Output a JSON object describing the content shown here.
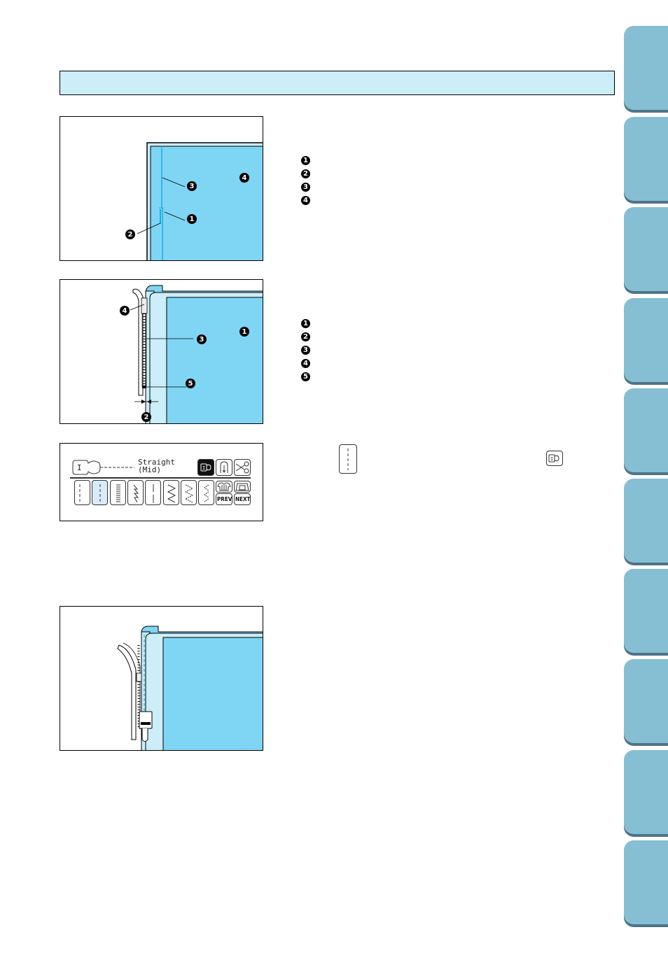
{
  "header": {
    "title": ""
  },
  "figure1": {
    "callouts": [
      "1",
      "2",
      "3",
      "4"
    ],
    "legend": [
      {
        "num": "1",
        "text": ""
      },
      {
        "num": "2",
        "text": ""
      },
      {
        "num": "3",
        "text": ""
      },
      {
        "num": "4",
        "text": ""
      }
    ]
  },
  "figure2": {
    "callouts": [
      "1",
      "2",
      "3",
      "4",
      "5"
    ],
    "legend": [
      {
        "num": "1",
        "text": ""
      },
      {
        "num": "2",
        "text": ""
      },
      {
        "num": "3",
        "text": ""
      },
      {
        "num": "4",
        "text": ""
      },
      {
        "num": "5",
        "text": ""
      }
    ]
  },
  "lcd": {
    "foot_label": "I",
    "stitch_name_line1": "Straight",
    "stitch_name_line2": "(Mid)",
    "prev_label": "PREV",
    "next_label": "NEXT",
    "selected_stitch_index": 1,
    "stitch_icons": [
      "straight-left",
      "straight-middle",
      "triple-straight",
      "stretch",
      "straight-center",
      "zigzag",
      "zigzag-3step",
      "zigzag-right"
    ]
  },
  "inline_icons": {
    "stitch_key": "straight-stitch-middle-icon",
    "foot_key": "presser-foot-I-icon",
    "foot_key_label": "I"
  },
  "side_tabs": {
    "count": 10,
    "color": "#86bfd4",
    "shadow_color": "#4e7486"
  },
  "colors": {
    "fabric": "#7fd5f4",
    "fabric_light": "#cbeef9",
    "header": "#cbeef9"
  }
}
